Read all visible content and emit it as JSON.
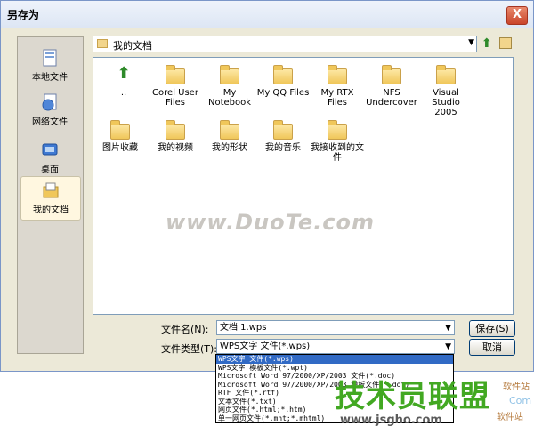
{
  "window": {
    "title": "另存为",
    "close": "X"
  },
  "places": [
    {
      "label": "本地文件",
      "icon": "document-icon"
    },
    {
      "label": "网络文件",
      "icon": "globe-document-icon"
    },
    {
      "label": "桌面",
      "icon": "desktop-icon"
    },
    {
      "label": "我的文档",
      "icon": "folder-documents-icon"
    }
  ],
  "path": {
    "current": "我的文档"
  },
  "items": [
    {
      "label": "..",
      "type": "up"
    },
    {
      "label": "Corel User Files",
      "type": "folder"
    },
    {
      "label": "My Notebook",
      "type": "folder"
    },
    {
      "label": "My QQ Files",
      "type": "folder"
    },
    {
      "label": "My RTX Files",
      "type": "folder"
    },
    {
      "label": "NFS Undercover",
      "type": "folder"
    },
    {
      "label": "Visual Studio 2005",
      "type": "folder"
    },
    {
      "label": "图片收藏",
      "type": "folder"
    },
    {
      "label": "我的视频",
      "type": "folder"
    },
    {
      "label": "我的形状",
      "type": "folder"
    },
    {
      "label": "我的音乐",
      "type": "folder"
    },
    {
      "label": "我接收到的文件",
      "type": "folder"
    }
  ],
  "watermark": "www.DuoTe.com",
  "filename": {
    "label": "文件名(N):",
    "value": "文档 1.wps"
  },
  "filetype": {
    "label": "文件类型(T):",
    "value": "WPS文字 文件(*.wps)"
  },
  "buttons": {
    "save": "保存(S)",
    "cancel": "取消"
  },
  "filetype_options": [
    "WPS文字 文件(*.wps)",
    "WPS文字 模板文件(*.wpt)",
    "Microsoft Word 97/2000/XP/2003 文件(*.doc)",
    "Microsoft Word 97/2000/XP/2003 模板文件(*.dot)",
    "RTF 文件(*.rtf)",
    "文本文件(*.txt)",
    "网页文件(*.html;*.htm)",
    "单一网页文件(*.mht;*.mhtml)"
  ],
  "logo": {
    "main": "技术员联盟",
    "url": "www.jsgho.com",
    "side_top": "软件站",
    "side_com": "Com",
    "side_bottom": "软件站"
  },
  "colors": {
    "accent_green": "#42a822",
    "selection_blue": "#316ac5"
  }
}
